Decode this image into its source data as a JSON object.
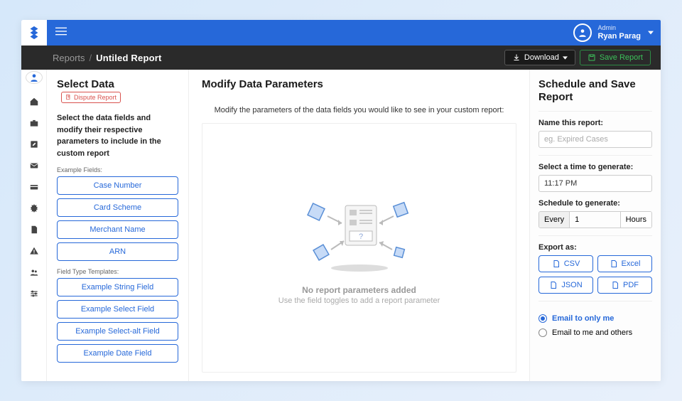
{
  "topbar": {
    "user_role": "Admin",
    "user_name": "Ryan Parag"
  },
  "subbar": {
    "crumb_root": "Reports",
    "crumb_current": "Untiled Report",
    "download_label": "Download",
    "save_label": "Save Report"
  },
  "left": {
    "title": "Select Data",
    "badge": "Dispute Report",
    "desc": "Select the data fields and modify their respective parameters to include in the custom report",
    "example_label": "Example Fields:",
    "example_fields": [
      "Case Number",
      "Card Scheme",
      "Merchant Name",
      "ARN"
    ],
    "template_label": "Field Type Templates:",
    "template_fields": [
      "Example String Field",
      "Example Select Field",
      "Example Select-alt Field",
      "Example Date Field"
    ]
  },
  "center": {
    "title": "Modify Data Parameters",
    "sub": "Modify the parameters of the data fields you would like to see in your custom report:",
    "empty_title": "No report parameters added",
    "empty_sub": "Use the field toggles to add a report parameter"
  },
  "right": {
    "title": "Schedule and Save Report",
    "name_label": "Name this report:",
    "name_placeholder": "eg. Expired Cases",
    "time_label": "Select a time to generate:",
    "time_value": "11:17 PM",
    "sched_label": "Schedule to generate:",
    "sched_every": "Every",
    "sched_val": "1",
    "sched_unit": "Hours",
    "export_label": "Export as:",
    "export_csv": "CSV",
    "export_excel": "Excel",
    "export_json": "JSON",
    "export_pdf": "PDF",
    "radio_only_me": "Email to only me",
    "radio_others": "Email to me and others"
  }
}
